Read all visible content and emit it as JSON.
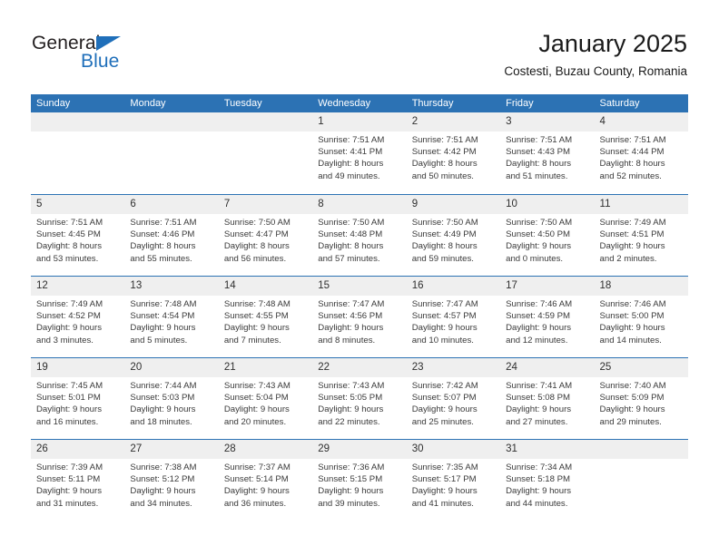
{
  "brand": {
    "name_top": "General",
    "name_bottom": "Blue",
    "accent_color": "#1f6fba"
  },
  "header": {
    "title": "January 2025",
    "subtitle": "Costesti, Buzau County, Romania"
  },
  "calendar": {
    "header_bg": "#2c72b4",
    "daynumber_bg": "#efefef",
    "weekdays": [
      "Sunday",
      "Monday",
      "Tuesday",
      "Wednesday",
      "Thursday",
      "Friday",
      "Saturday"
    ],
    "weeks": [
      [
        {
          "day": "",
          "empty": true
        },
        {
          "day": "",
          "empty": true
        },
        {
          "day": "",
          "empty": true
        },
        {
          "day": "1",
          "sunrise": "Sunrise: 7:51 AM",
          "sunset": "Sunset: 4:41 PM",
          "daylight_line1": "Daylight: 8 hours",
          "daylight_line2": "and 49 minutes."
        },
        {
          "day": "2",
          "sunrise": "Sunrise: 7:51 AM",
          "sunset": "Sunset: 4:42 PM",
          "daylight_line1": "Daylight: 8 hours",
          "daylight_line2": "and 50 minutes."
        },
        {
          "day": "3",
          "sunrise": "Sunrise: 7:51 AM",
          "sunset": "Sunset: 4:43 PM",
          "daylight_line1": "Daylight: 8 hours",
          "daylight_line2": "and 51 minutes."
        },
        {
          "day": "4",
          "sunrise": "Sunrise: 7:51 AM",
          "sunset": "Sunset: 4:44 PM",
          "daylight_line1": "Daylight: 8 hours",
          "daylight_line2": "and 52 minutes."
        }
      ],
      [
        {
          "day": "5",
          "sunrise": "Sunrise: 7:51 AM",
          "sunset": "Sunset: 4:45 PM",
          "daylight_line1": "Daylight: 8 hours",
          "daylight_line2": "and 53 minutes."
        },
        {
          "day": "6",
          "sunrise": "Sunrise: 7:51 AM",
          "sunset": "Sunset: 4:46 PM",
          "daylight_line1": "Daylight: 8 hours",
          "daylight_line2": "and 55 minutes."
        },
        {
          "day": "7",
          "sunrise": "Sunrise: 7:50 AM",
          "sunset": "Sunset: 4:47 PM",
          "daylight_line1": "Daylight: 8 hours",
          "daylight_line2": "and 56 minutes."
        },
        {
          "day": "8",
          "sunrise": "Sunrise: 7:50 AM",
          "sunset": "Sunset: 4:48 PM",
          "daylight_line1": "Daylight: 8 hours",
          "daylight_line2": "and 57 minutes."
        },
        {
          "day": "9",
          "sunrise": "Sunrise: 7:50 AM",
          "sunset": "Sunset: 4:49 PM",
          "daylight_line1": "Daylight: 8 hours",
          "daylight_line2": "and 59 minutes."
        },
        {
          "day": "10",
          "sunrise": "Sunrise: 7:50 AM",
          "sunset": "Sunset: 4:50 PM",
          "daylight_line1": "Daylight: 9 hours",
          "daylight_line2": "and 0 minutes."
        },
        {
          "day": "11",
          "sunrise": "Sunrise: 7:49 AM",
          "sunset": "Sunset: 4:51 PM",
          "daylight_line1": "Daylight: 9 hours",
          "daylight_line2": "and 2 minutes."
        }
      ],
      [
        {
          "day": "12",
          "sunrise": "Sunrise: 7:49 AM",
          "sunset": "Sunset: 4:52 PM",
          "daylight_line1": "Daylight: 9 hours",
          "daylight_line2": "and 3 minutes."
        },
        {
          "day": "13",
          "sunrise": "Sunrise: 7:48 AM",
          "sunset": "Sunset: 4:54 PM",
          "daylight_line1": "Daylight: 9 hours",
          "daylight_line2": "and 5 minutes."
        },
        {
          "day": "14",
          "sunrise": "Sunrise: 7:48 AM",
          "sunset": "Sunset: 4:55 PM",
          "daylight_line1": "Daylight: 9 hours",
          "daylight_line2": "and 7 minutes."
        },
        {
          "day": "15",
          "sunrise": "Sunrise: 7:47 AM",
          "sunset": "Sunset: 4:56 PM",
          "daylight_line1": "Daylight: 9 hours",
          "daylight_line2": "and 8 minutes."
        },
        {
          "day": "16",
          "sunrise": "Sunrise: 7:47 AM",
          "sunset": "Sunset: 4:57 PM",
          "daylight_line1": "Daylight: 9 hours",
          "daylight_line2": "and 10 minutes."
        },
        {
          "day": "17",
          "sunrise": "Sunrise: 7:46 AM",
          "sunset": "Sunset: 4:59 PM",
          "daylight_line1": "Daylight: 9 hours",
          "daylight_line2": "and 12 minutes."
        },
        {
          "day": "18",
          "sunrise": "Sunrise: 7:46 AM",
          "sunset": "Sunset: 5:00 PM",
          "daylight_line1": "Daylight: 9 hours",
          "daylight_line2": "and 14 minutes."
        }
      ],
      [
        {
          "day": "19",
          "sunrise": "Sunrise: 7:45 AM",
          "sunset": "Sunset: 5:01 PM",
          "daylight_line1": "Daylight: 9 hours",
          "daylight_line2": "and 16 minutes."
        },
        {
          "day": "20",
          "sunrise": "Sunrise: 7:44 AM",
          "sunset": "Sunset: 5:03 PM",
          "daylight_line1": "Daylight: 9 hours",
          "daylight_line2": "and 18 minutes."
        },
        {
          "day": "21",
          "sunrise": "Sunrise: 7:43 AM",
          "sunset": "Sunset: 5:04 PM",
          "daylight_line1": "Daylight: 9 hours",
          "daylight_line2": "and 20 minutes."
        },
        {
          "day": "22",
          "sunrise": "Sunrise: 7:43 AM",
          "sunset": "Sunset: 5:05 PM",
          "daylight_line1": "Daylight: 9 hours",
          "daylight_line2": "and 22 minutes."
        },
        {
          "day": "23",
          "sunrise": "Sunrise: 7:42 AM",
          "sunset": "Sunset: 5:07 PM",
          "daylight_line1": "Daylight: 9 hours",
          "daylight_line2": "and 25 minutes."
        },
        {
          "day": "24",
          "sunrise": "Sunrise: 7:41 AM",
          "sunset": "Sunset: 5:08 PM",
          "daylight_line1": "Daylight: 9 hours",
          "daylight_line2": "and 27 minutes."
        },
        {
          "day": "25",
          "sunrise": "Sunrise: 7:40 AM",
          "sunset": "Sunset: 5:09 PM",
          "daylight_line1": "Daylight: 9 hours",
          "daylight_line2": "and 29 minutes."
        }
      ],
      [
        {
          "day": "26",
          "sunrise": "Sunrise: 7:39 AM",
          "sunset": "Sunset: 5:11 PM",
          "daylight_line1": "Daylight: 9 hours",
          "daylight_line2": "and 31 minutes."
        },
        {
          "day": "27",
          "sunrise": "Sunrise: 7:38 AM",
          "sunset": "Sunset: 5:12 PM",
          "daylight_line1": "Daylight: 9 hours",
          "daylight_line2": "and 34 minutes."
        },
        {
          "day": "28",
          "sunrise": "Sunrise: 7:37 AM",
          "sunset": "Sunset: 5:14 PM",
          "daylight_line1": "Daylight: 9 hours",
          "daylight_line2": "and 36 minutes."
        },
        {
          "day": "29",
          "sunrise": "Sunrise: 7:36 AM",
          "sunset": "Sunset: 5:15 PM",
          "daylight_line1": "Daylight: 9 hours",
          "daylight_line2": "and 39 minutes."
        },
        {
          "day": "30",
          "sunrise": "Sunrise: 7:35 AM",
          "sunset": "Sunset: 5:17 PM",
          "daylight_line1": "Daylight: 9 hours",
          "daylight_line2": "and 41 minutes."
        },
        {
          "day": "31",
          "sunrise": "Sunrise: 7:34 AM",
          "sunset": "Sunset: 5:18 PM",
          "daylight_line1": "Daylight: 9 hours",
          "daylight_line2": "and 44 minutes."
        },
        {
          "day": "",
          "empty": true
        }
      ]
    ]
  }
}
